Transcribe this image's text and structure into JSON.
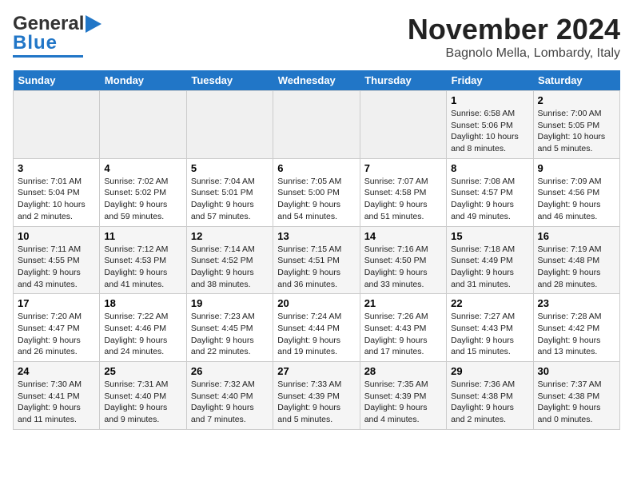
{
  "header": {
    "logo_line1": "General",
    "logo_line2": "Blue",
    "month": "November 2024",
    "location": "Bagnolo Mella, Lombardy, Italy"
  },
  "days_of_week": [
    "Sunday",
    "Monday",
    "Tuesday",
    "Wednesday",
    "Thursday",
    "Friday",
    "Saturday"
  ],
  "weeks": [
    [
      {
        "day": "",
        "detail": ""
      },
      {
        "day": "",
        "detail": ""
      },
      {
        "day": "",
        "detail": ""
      },
      {
        "day": "",
        "detail": ""
      },
      {
        "day": "",
        "detail": ""
      },
      {
        "day": "1",
        "detail": "Sunrise: 6:58 AM\nSunset: 5:06 PM\nDaylight: 10 hours\nand 8 minutes."
      },
      {
        "day": "2",
        "detail": "Sunrise: 7:00 AM\nSunset: 5:05 PM\nDaylight: 10 hours\nand 5 minutes."
      }
    ],
    [
      {
        "day": "3",
        "detail": "Sunrise: 7:01 AM\nSunset: 5:04 PM\nDaylight: 10 hours\nand 2 minutes."
      },
      {
        "day": "4",
        "detail": "Sunrise: 7:02 AM\nSunset: 5:02 PM\nDaylight: 9 hours\nand 59 minutes."
      },
      {
        "day": "5",
        "detail": "Sunrise: 7:04 AM\nSunset: 5:01 PM\nDaylight: 9 hours\nand 57 minutes."
      },
      {
        "day": "6",
        "detail": "Sunrise: 7:05 AM\nSunset: 5:00 PM\nDaylight: 9 hours\nand 54 minutes."
      },
      {
        "day": "7",
        "detail": "Sunrise: 7:07 AM\nSunset: 4:58 PM\nDaylight: 9 hours\nand 51 minutes."
      },
      {
        "day": "8",
        "detail": "Sunrise: 7:08 AM\nSunset: 4:57 PM\nDaylight: 9 hours\nand 49 minutes."
      },
      {
        "day": "9",
        "detail": "Sunrise: 7:09 AM\nSunset: 4:56 PM\nDaylight: 9 hours\nand 46 minutes."
      }
    ],
    [
      {
        "day": "10",
        "detail": "Sunrise: 7:11 AM\nSunset: 4:55 PM\nDaylight: 9 hours\nand 43 minutes."
      },
      {
        "day": "11",
        "detail": "Sunrise: 7:12 AM\nSunset: 4:53 PM\nDaylight: 9 hours\nand 41 minutes."
      },
      {
        "day": "12",
        "detail": "Sunrise: 7:14 AM\nSunset: 4:52 PM\nDaylight: 9 hours\nand 38 minutes."
      },
      {
        "day": "13",
        "detail": "Sunrise: 7:15 AM\nSunset: 4:51 PM\nDaylight: 9 hours\nand 36 minutes."
      },
      {
        "day": "14",
        "detail": "Sunrise: 7:16 AM\nSunset: 4:50 PM\nDaylight: 9 hours\nand 33 minutes."
      },
      {
        "day": "15",
        "detail": "Sunrise: 7:18 AM\nSunset: 4:49 PM\nDaylight: 9 hours\nand 31 minutes."
      },
      {
        "day": "16",
        "detail": "Sunrise: 7:19 AM\nSunset: 4:48 PM\nDaylight: 9 hours\nand 28 minutes."
      }
    ],
    [
      {
        "day": "17",
        "detail": "Sunrise: 7:20 AM\nSunset: 4:47 PM\nDaylight: 9 hours\nand 26 minutes."
      },
      {
        "day": "18",
        "detail": "Sunrise: 7:22 AM\nSunset: 4:46 PM\nDaylight: 9 hours\nand 24 minutes."
      },
      {
        "day": "19",
        "detail": "Sunrise: 7:23 AM\nSunset: 4:45 PM\nDaylight: 9 hours\nand 22 minutes."
      },
      {
        "day": "20",
        "detail": "Sunrise: 7:24 AM\nSunset: 4:44 PM\nDaylight: 9 hours\nand 19 minutes."
      },
      {
        "day": "21",
        "detail": "Sunrise: 7:26 AM\nSunset: 4:43 PM\nDaylight: 9 hours\nand 17 minutes."
      },
      {
        "day": "22",
        "detail": "Sunrise: 7:27 AM\nSunset: 4:43 PM\nDaylight: 9 hours\nand 15 minutes."
      },
      {
        "day": "23",
        "detail": "Sunrise: 7:28 AM\nSunset: 4:42 PM\nDaylight: 9 hours\nand 13 minutes."
      }
    ],
    [
      {
        "day": "24",
        "detail": "Sunrise: 7:30 AM\nSunset: 4:41 PM\nDaylight: 9 hours\nand 11 minutes."
      },
      {
        "day": "25",
        "detail": "Sunrise: 7:31 AM\nSunset: 4:40 PM\nDaylight: 9 hours\nand 9 minutes."
      },
      {
        "day": "26",
        "detail": "Sunrise: 7:32 AM\nSunset: 4:40 PM\nDaylight: 9 hours\nand 7 minutes."
      },
      {
        "day": "27",
        "detail": "Sunrise: 7:33 AM\nSunset: 4:39 PM\nDaylight: 9 hours\nand 5 minutes."
      },
      {
        "day": "28",
        "detail": "Sunrise: 7:35 AM\nSunset: 4:39 PM\nDaylight: 9 hours\nand 4 minutes."
      },
      {
        "day": "29",
        "detail": "Sunrise: 7:36 AM\nSunset: 4:38 PM\nDaylight: 9 hours\nand 2 minutes."
      },
      {
        "day": "30",
        "detail": "Sunrise: 7:37 AM\nSunset: 4:38 PM\nDaylight: 9 hours\nand 0 minutes."
      }
    ]
  ]
}
